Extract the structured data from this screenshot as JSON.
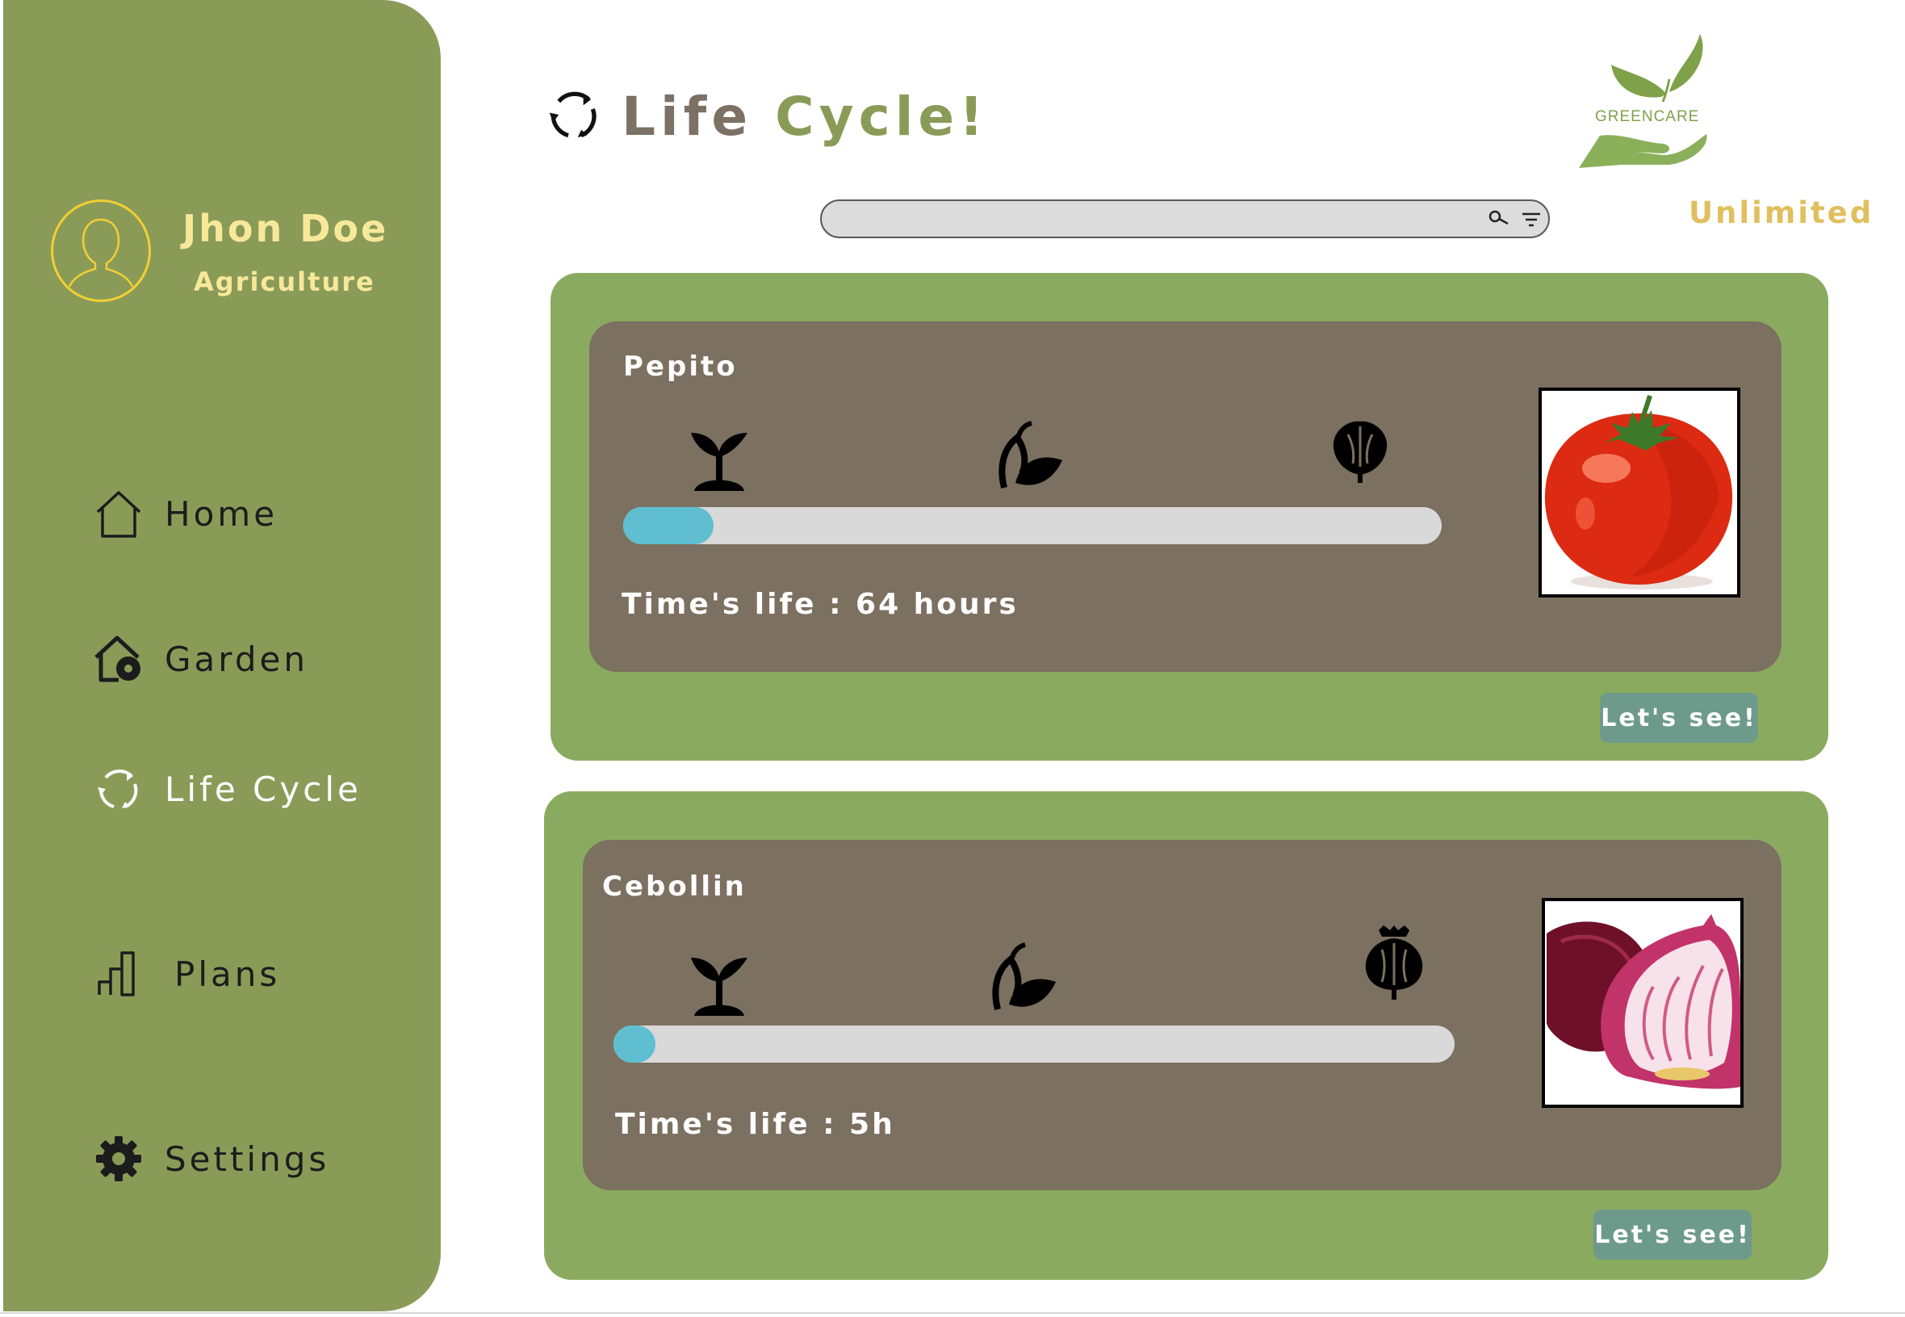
{
  "colors": {
    "sidebar": "#8a9b58",
    "card": "#8aab5f",
    "panel": "#7c7061",
    "progress_fill": "#5fbfd1",
    "accent_gold": "#e0bf5e",
    "title_brown": "#7c7164",
    "cta": "#6e9a8c"
  },
  "user": {
    "name": "Jhon Doe",
    "role": "Agriculture",
    "avatar_icon": "user-silhouette-icon"
  },
  "sidebar": {
    "items": [
      {
        "label": "Home",
        "icon": "home-icon"
      },
      {
        "label": "Garden",
        "icon": "garden-icon"
      },
      {
        "label": "Life Cycle",
        "icon": "cycle-icon",
        "active": true
      },
      {
        "label": "Plans",
        "icon": "bar-chart-icon"
      },
      {
        "label": "Settings",
        "icon": "gear-icon"
      }
    ]
  },
  "header": {
    "title_part1": "Life",
    "title_part2": "Cycle!",
    "title_icon": "cycle-icon",
    "brand": "GREENCARE",
    "plan": "Unlimited"
  },
  "search": {
    "placeholder": "",
    "value": "",
    "search_icon": "search-icon",
    "filter_icon": "filter-icon"
  },
  "plants": [
    {
      "name": "Pepito",
      "progress": 0.11,
      "life": "Time's life : 64 hours",
      "stages": [
        "sprout-icon",
        "leaves-icon",
        "fruit-icon"
      ],
      "image": "tomato",
      "button": "Let's see!"
    },
    {
      "name": "Cebollin",
      "progress": 0.05,
      "life": "Time's life : 5h",
      "stages": [
        "sprout-icon",
        "leaves-icon",
        "bulb-icon"
      ],
      "image": "red-onion",
      "button": "Let's see!"
    }
  ]
}
